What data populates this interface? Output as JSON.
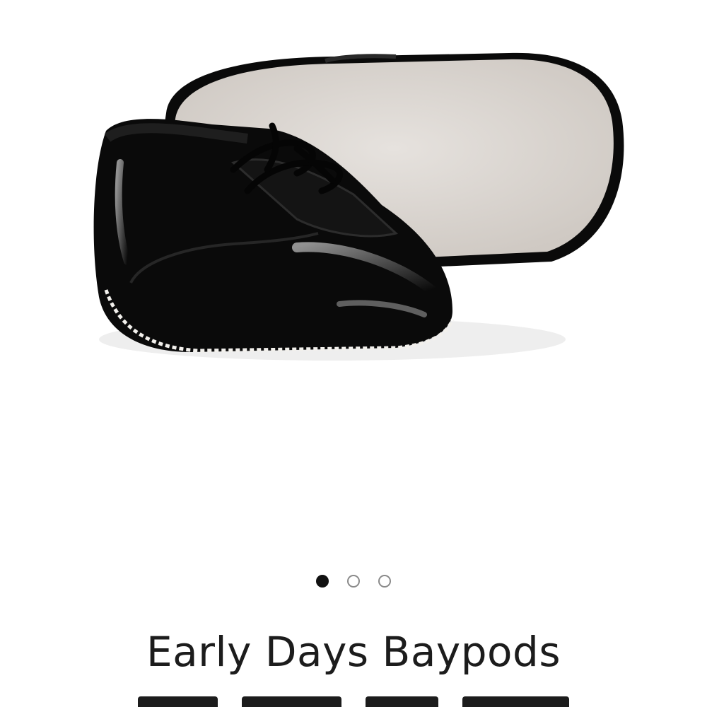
{
  "product": {
    "title": "Early Days Baypods",
    "image_alt": "Black patent leather baby shoes"
  },
  "carousel": {
    "dots": [
      {
        "state": "active"
      },
      {
        "state": "inactive"
      },
      {
        "state": "inactive"
      }
    ]
  },
  "colors": {
    "text": "#1c1c1c",
    "dot_active": "#111111",
    "dot_inactive_border": "#8a8a8a",
    "shoe": "#0a0a0a",
    "sole": "#d9d4cf"
  }
}
